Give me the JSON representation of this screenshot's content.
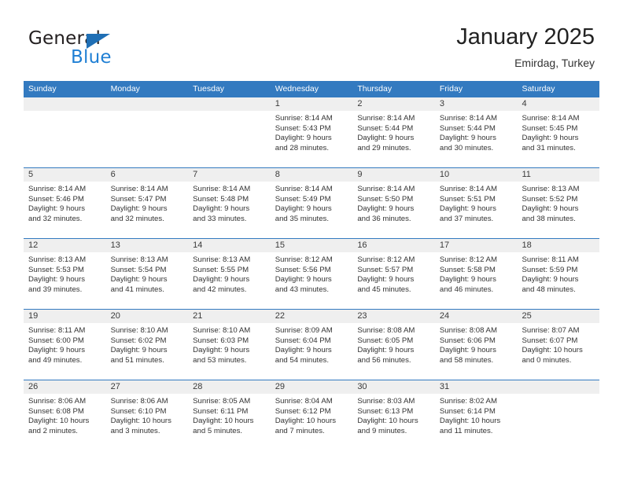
{
  "logo": {
    "word_one": "General",
    "word_two": "Blue",
    "triangle_color": "#1f6fb5",
    "blue_color": "#1f7fd4"
  },
  "header": {
    "title": "January 2025",
    "subtitle": "Emirdag, Turkey"
  },
  "theme": {
    "header_blue": "#337ac0",
    "daynum_bg": "#efefef",
    "text": "#333333"
  },
  "weekdays": [
    "Sunday",
    "Monday",
    "Tuesday",
    "Wednesday",
    "Thursday",
    "Friday",
    "Saturday"
  ],
  "weeks": [
    [
      {
        "day": "",
        "empty": true
      },
      {
        "day": "",
        "empty": true
      },
      {
        "day": "",
        "empty": true
      },
      {
        "day": "1",
        "sunrise": "Sunrise: 8:14 AM",
        "sunset": "Sunset: 5:43 PM",
        "daylight1": "Daylight: 9 hours",
        "daylight2": "and 28 minutes."
      },
      {
        "day": "2",
        "sunrise": "Sunrise: 8:14 AM",
        "sunset": "Sunset: 5:44 PM",
        "daylight1": "Daylight: 9 hours",
        "daylight2": "and 29 minutes."
      },
      {
        "day": "3",
        "sunrise": "Sunrise: 8:14 AM",
        "sunset": "Sunset: 5:44 PM",
        "daylight1": "Daylight: 9 hours",
        "daylight2": "and 30 minutes."
      },
      {
        "day": "4",
        "sunrise": "Sunrise: 8:14 AM",
        "sunset": "Sunset: 5:45 PM",
        "daylight1": "Daylight: 9 hours",
        "daylight2": "and 31 minutes."
      }
    ],
    [
      {
        "day": "5",
        "sunrise": "Sunrise: 8:14 AM",
        "sunset": "Sunset: 5:46 PM",
        "daylight1": "Daylight: 9 hours",
        "daylight2": "and 32 minutes."
      },
      {
        "day": "6",
        "sunrise": "Sunrise: 8:14 AM",
        "sunset": "Sunset: 5:47 PM",
        "daylight1": "Daylight: 9 hours",
        "daylight2": "and 32 minutes."
      },
      {
        "day": "7",
        "sunrise": "Sunrise: 8:14 AM",
        "sunset": "Sunset: 5:48 PM",
        "daylight1": "Daylight: 9 hours",
        "daylight2": "and 33 minutes."
      },
      {
        "day": "8",
        "sunrise": "Sunrise: 8:14 AM",
        "sunset": "Sunset: 5:49 PM",
        "daylight1": "Daylight: 9 hours",
        "daylight2": "and 35 minutes."
      },
      {
        "day": "9",
        "sunrise": "Sunrise: 8:14 AM",
        "sunset": "Sunset: 5:50 PM",
        "daylight1": "Daylight: 9 hours",
        "daylight2": "and 36 minutes."
      },
      {
        "day": "10",
        "sunrise": "Sunrise: 8:14 AM",
        "sunset": "Sunset: 5:51 PM",
        "daylight1": "Daylight: 9 hours",
        "daylight2": "and 37 minutes."
      },
      {
        "day": "11",
        "sunrise": "Sunrise: 8:13 AM",
        "sunset": "Sunset: 5:52 PM",
        "daylight1": "Daylight: 9 hours",
        "daylight2": "and 38 minutes."
      }
    ],
    [
      {
        "day": "12",
        "sunrise": "Sunrise: 8:13 AM",
        "sunset": "Sunset: 5:53 PM",
        "daylight1": "Daylight: 9 hours",
        "daylight2": "and 39 minutes."
      },
      {
        "day": "13",
        "sunrise": "Sunrise: 8:13 AM",
        "sunset": "Sunset: 5:54 PM",
        "daylight1": "Daylight: 9 hours",
        "daylight2": "and 41 minutes."
      },
      {
        "day": "14",
        "sunrise": "Sunrise: 8:13 AM",
        "sunset": "Sunset: 5:55 PM",
        "daylight1": "Daylight: 9 hours",
        "daylight2": "and 42 minutes."
      },
      {
        "day": "15",
        "sunrise": "Sunrise: 8:12 AM",
        "sunset": "Sunset: 5:56 PM",
        "daylight1": "Daylight: 9 hours",
        "daylight2": "and 43 minutes."
      },
      {
        "day": "16",
        "sunrise": "Sunrise: 8:12 AM",
        "sunset": "Sunset: 5:57 PM",
        "daylight1": "Daylight: 9 hours",
        "daylight2": "and 45 minutes."
      },
      {
        "day": "17",
        "sunrise": "Sunrise: 8:12 AM",
        "sunset": "Sunset: 5:58 PM",
        "daylight1": "Daylight: 9 hours",
        "daylight2": "and 46 minutes."
      },
      {
        "day": "18",
        "sunrise": "Sunrise: 8:11 AM",
        "sunset": "Sunset: 5:59 PM",
        "daylight1": "Daylight: 9 hours",
        "daylight2": "and 48 minutes."
      }
    ],
    [
      {
        "day": "19",
        "sunrise": "Sunrise: 8:11 AM",
        "sunset": "Sunset: 6:00 PM",
        "daylight1": "Daylight: 9 hours",
        "daylight2": "and 49 minutes."
      },
      {
        "day": "20",
        "sunrise": "Sunrise: 8:10 AM",
        "sunset": "Sunset: 6:02 PM",
        "daylight1": "Daylight: 9 hours",
        "daylight2": "and 51 minutes."
      },
      {
        "day": "21",
        "sunrise": "Sunrise: 8:10 AM",
        "sunset": "Sunset: 6:03 PM",
        "daylight1": "Daylight: 9 hours",
        "daylight2": "and 53 minutes."
      },
      {
        "day": "22",
        "sunrise": "Sunrise: 8:09 AM",
        "sunset": "Sunset: 6:04 PM",
        "daylight1": "Daylight: 9 hours",
        "daylight2": "and 54 minutes."
      },
      {
        "day": "23",
        "sunrise": "Sunrise: 8:08 AM",
        "sunset": "Sunset: 6:05 PM",
        "daylight1": "Daylight: 9 hours",
        "daylight2": "and 56 minutes."
      },
      {
        "day": "24",
        "sunrise": "Sunrise: 8:08 AM",
        "sunset": "Sunset: 6:06 PM",
        "daylight1": "Daylight: 9 hours",
        "daylight2": "and 58 minutes."
      },
      {
        "day": "25",
        "sunrise": "Sunrise: 8:07 AM",
        "sunset": "Sunset: 6:07 PM",
        "daylight1": "Daylight: 10 hours",
        "daylight2": "and 0 minutes."
      }
    ],
    [
      {
        "day": "26",
        "sunrise": "Sunrise: 8:06 AM",
        "sunset": "Sunset: 6:08 PM",
        "daylight1": "Daylight: 10 hours",
        "daylight2": "and 2 minutes."
      },
      {
        "day": "27",
        "sunrise": "Sunrise: 8:06 AM",
        "sunset": "Sunset: 6:10 PM",
        "daylight1": "Daylight: 10 hours",
        "daylight2": "and 3 minutes."
      },
      {
        "day": "28",
        "sunrise": "Sunrise: 8:05 AM",
        "sunset": "Sunset: 6:11 PM",
        "daylight1": "Daylight: 10 hours",
        "daylight2": "and 5 minutes."
      },
      {
        "day": "29",
        "sunrise": "Sunrise: 8:04 AM",
        "sunset": "Sunset: 6:12 PM",
        "daylight1": "Daylight: 10 hours",
        "daylight2": "and 7 minutes."
      },
      {
        "day": "30",
        "sunrise": "Sunrise: 8:03 AM",
        "sunset": "Sunset: 6:13 PM",
        "daylight1": "Daylight: 10 hours",
        "daylight2": "and 9 minutes."
      },
      {
        "day": "31",
        "sunrise": "Sunrise: 8:02 AM",
        "sunset": "Sunset: 6:14 PM",
        "daylight1": "Daylight: 10 hours",
        "daylight2": "and 11 minutes."
      },
      {
        "day": "",
        "empty": true
      }
    ]
  ]
}
